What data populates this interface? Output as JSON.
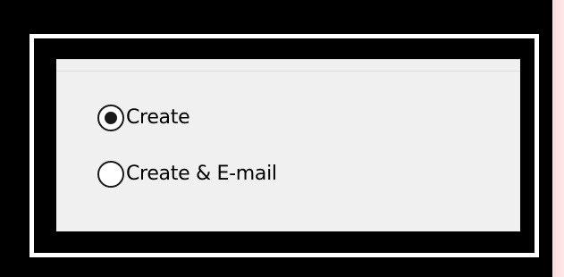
{
  "options": [
    {
      "label": "Create",
      "selected": true
    },
    {
      "label": "Create & E-mail",
      "selected": false
    }
  ],
  "colors": {
    "panel_background": "#f0f0f0",
    "frame_black": "#000000",
    "frame_white": "#ffffff",
    "radio_border": "#1a1a1a"
  }
}
